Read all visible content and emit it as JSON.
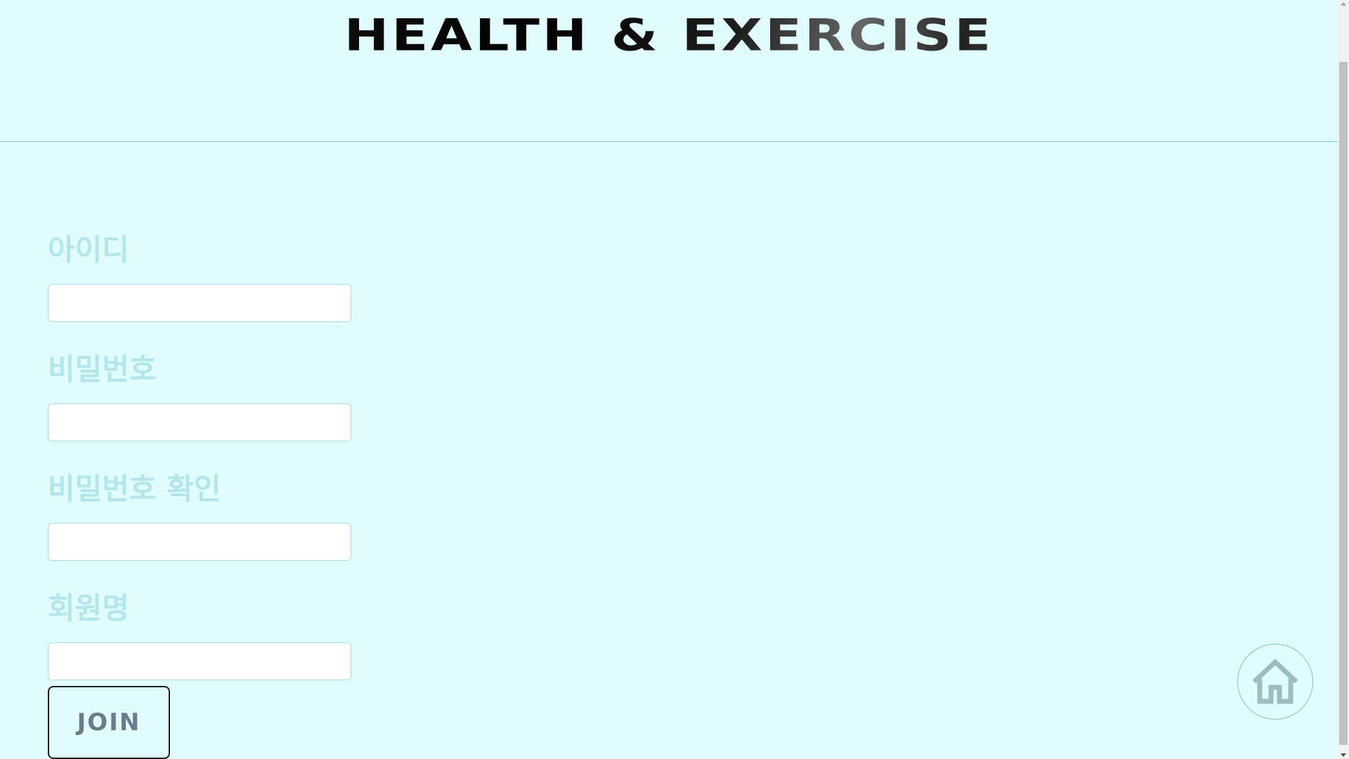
{
  "header": {
    "title": "HEALTH & EXERCISE"
  },
  "form": {
    "fields": [
      {
        "label": "아이디",
        "value": "",
        "placeholder": ""
      },
      {
        "label": "비밀번호",
        "value": "",
        "placeholder": ""
      },
      {
        "label": "비밀번호 확인",
        "value": "",
        "placeholder": ""
      },
      {
        "label": "회원명",
        "value": "",
        "placeholder": ""
      }
    ],
    "submit_label": "JOIN"
  },
  "home_button": {
    "icon": "home-icon"
  },
  "colors": {
    "background": "#e0fcfc",
    "label": "#b2e6ea",
    "divider": "#6fc9c4",
    "button_text": "#6c7a8c",
    "home_icon": "#9dbdbd"
  }
}
